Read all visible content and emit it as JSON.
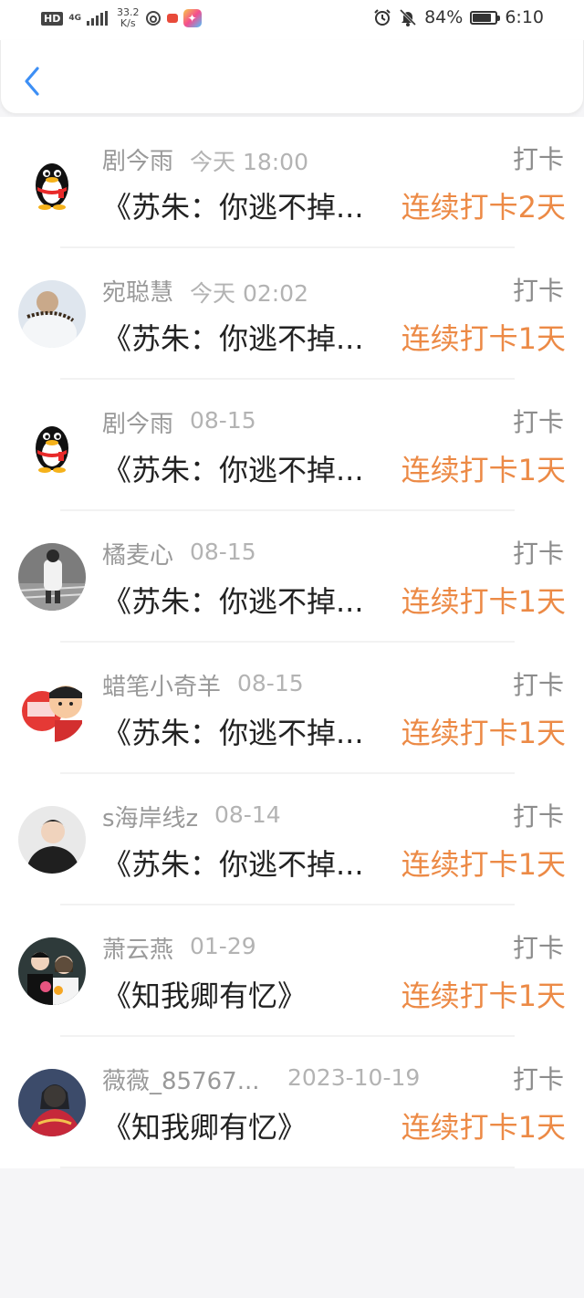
{
  "status_bar": {
    "hd": "HD",
    "network": "4G",
    "speed_value": "33.2",
    "speed_unit": "K/s",
    "battery": "84%",
    "battery_level": 0.84,
    "time": "6:10",
    "icons": [
      "signal-icon",
      "netease-music-icon",
      "notification-dot-icon",
      "app-icon",
      "alarm-icon",
      "mute-bell-icon",
      "battery-icon"
    ]
  },
  "header": {
    "back_icon": "chevron-left-icon",
    "accent": "#3d8ff5"
  },
  "list": {
    "tag_color": "#8c8c8c",
    "streak_color": "#ec8a46",
    "items": [
      {
        "name": "剧今雨",
        "time": "今天 18:00",
        "tag": "打卡",
        "book": "《苏朱：你逃不掉...",
        "streak": "连续打卡2天",
        "avatar": "qq-penguin"
      },
      {
        "name": "宛聪慧",
        "time": "今天 02:02",
        "tag": "打卡",
        "book": "《苏朱：你逃不掉...",
        "streak": "连续打卡1天",
        "avatar": "photo-light"
      },
      {
        "name": "剧今雨",
        "time": "08-15",
        "tag": "打卡",
        "book": "《苏朱：你逃不掉...",
        "streak": "连续打卡1天",
        "avatar": "qq-penguin"
      },
      {
        "name": "橘麦心",
        "time": "08-15",
        "tag": "打卡",
        "book": "《苏朱：你逃不掉...",
        "streak": "连续打卡1天",
        "avatar": "photo-street"
      },
      {
        "name": "蜡笔小奇羊",
        "time": "08-15",
        "tag": "打卡",
        "book": "《苏朱：你逃不掉...",
        "streak": "连续打卡1天",
        "avatar": "cartoon-red"
      },
      {
        "name": "s海岸线z",
        "time": "08-14",
        "tag": "打卡",
        "book": "《苏朱：你逃不掉...",
        "streak": "连续打卡1天",
        "avatar": "photo-dark"
      },
      {
        "name": "萧云燕",
        "time": "01-29",
        "tag": "打卡",
        "book": "《知我卿有忆》",
        "streak": "连续打卡1天",
        "avatar": "photo-couple"
      },
      {
        "name": "薇薇_85767...",
        "time": "2023-10-19",
        "tag": "打卡",
        "book": "《知我卿有忆》",
        "streak": "连续打卡1天",
        "avatar": "photo-costume"
      }
    ]
  }
}
